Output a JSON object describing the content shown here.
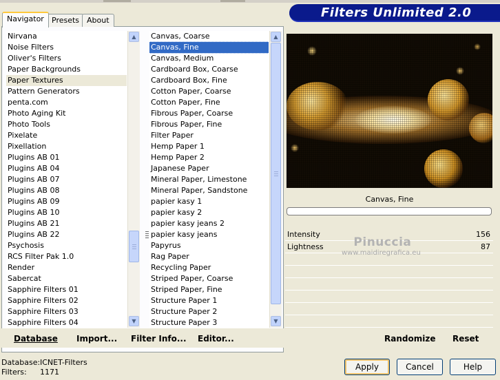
{
  "tabs": [
    {
      "label": "Navigator",
      "active": true
    },
    {
      "label": "Presets",
      "active": false
    },
    {
      "label": "About",
      "active": false
    }
  ],
  "banner": {
    "title": "Filters Unlimited 2.0"
  },
  "categories": {
    "items": [
      "Nirvana",
      "Noise Filters",
      "Oliver's Filters",
      "Paper Backgrounds",
      "Paper Textures",
      "Pattern Generators",
      "penta.com",
      "Photo Aging Kit",
      "Photo Tools",
      "Pixelate",
      "Pixellation",
      "Plugins AB 01",
      "Plugins AB 04",
      "Plugins AB 07",
      "Plugins AB 08",
      "Plugins AB 09",
      "Plugins AB 10",
      "Plugins AB 21",
      "Plugins AB 22",
      "Psychosis",
      "RCS Filter Pak 1.0",
      "Render",
      "Sabercat",
      "Sapphire Filters 01",
      "Sapphire Filters 02",
      "Sapphire Filters 03",
      "Sapphire Filters 04"
    ],
    "highlighted": "Paper Textures"
  },
  "filters": {
    "items": [
      "Canvas, Coarse",
      "Canvas, Fine",
      "Canvas, Medium",
      "Cardboard Box, Coarse",
      "Cardboard Box, Fine",
      "Cotton Paper, Coarse",
      "Cotton Paper, Fine",
      "Fibrous Paper, Coarse",
      "Fibrous Paper, Fine",
      "Filter Paper",
      "Hemp Paper 1",
      "Hemp Paper 2",
      "Japanese Paper",
      "Mineral Paper, Limestone",
      "Mineral Paper, Sandstone",
      "papier kasy 1",
      "papier kasy 2",
      "papier kasy jeans 2",
      "papier kasy jeans",
      "Papyrus",
      "Rag Paper",
      "Recycling Paper",
      "Striped Paper, Coarse",
      "Striped Paper, Fine",
      "Structure Paper 1",
      "Structure Paper 2",
      "Structure Paper 3"
    ],
    "selected": "Canvas, Fine"
  },
  "preview": {
    "caption": "Canvas, Fine"
  },
  "params": [
    {
      "label": "Intensity",
      "value": "156"
    },
    {
      "label": "Lightness",
      "value": "87"
    },
    {
      "label": "",
      "value": ""
    },
    {
      "label": "",
      "value": ""
    },
    {
      "label": "",
      "value": ""
    },
    {
      "label": "",
      "value": ""
    },
    {
      "label": "",
      "value": ""
    },
    {
      "label": "",
      "value": ""
    }
  ],
  "watermark": {
    "title": "Pinuccia",
    "url": "www.maidiregrafica.eu"
  },
  "links": {
    "database": "Database",
    "import": "Import...",
    "filter_info": "Filter Info...",
    "editor": "Editor...",
    "randomize": "Randomize",
    "reset": "Reset"
  },
  "status": {
    "database_label": "Database:",
    "database_value": "ICNET-Filters",
    "filters_label": "Filters:",
    "filters_value": "1171"
  },
  "buttons": {
    "apply": "Apply",
    "cancel": "Cancel",
    "help": "Help"
  },
  "icons": {
    "scroll_up": "arrow-up-icon",
    "scroll_down": "arrow-down-icon"
  }
}
